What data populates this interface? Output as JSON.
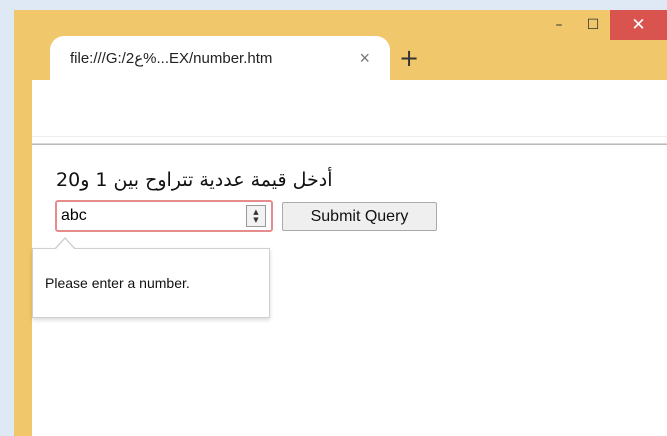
{
  "window": {
    "tab_title": "file:///G:/2ع%...EX/number.htm",
    "tab_close_icon": "×",
    "new_tab_icon": "+",
    "minimize_icon": "–",
    "maximize_icon": "☐",
    "close_icon": "✕",
    "accent_color": "#f0c76a",
    "close_color": "#d9534f"
  },
  "form": {
    "label": "أدخل قيمة عددية تتراوح بين 1 و20",
    "input_value": "abc",
    "submit_label": "Submit Query",
    "error_border_color": "#e78c8c"
  },
  "validation": {
    "message": "Please enter a number."
  }
}
